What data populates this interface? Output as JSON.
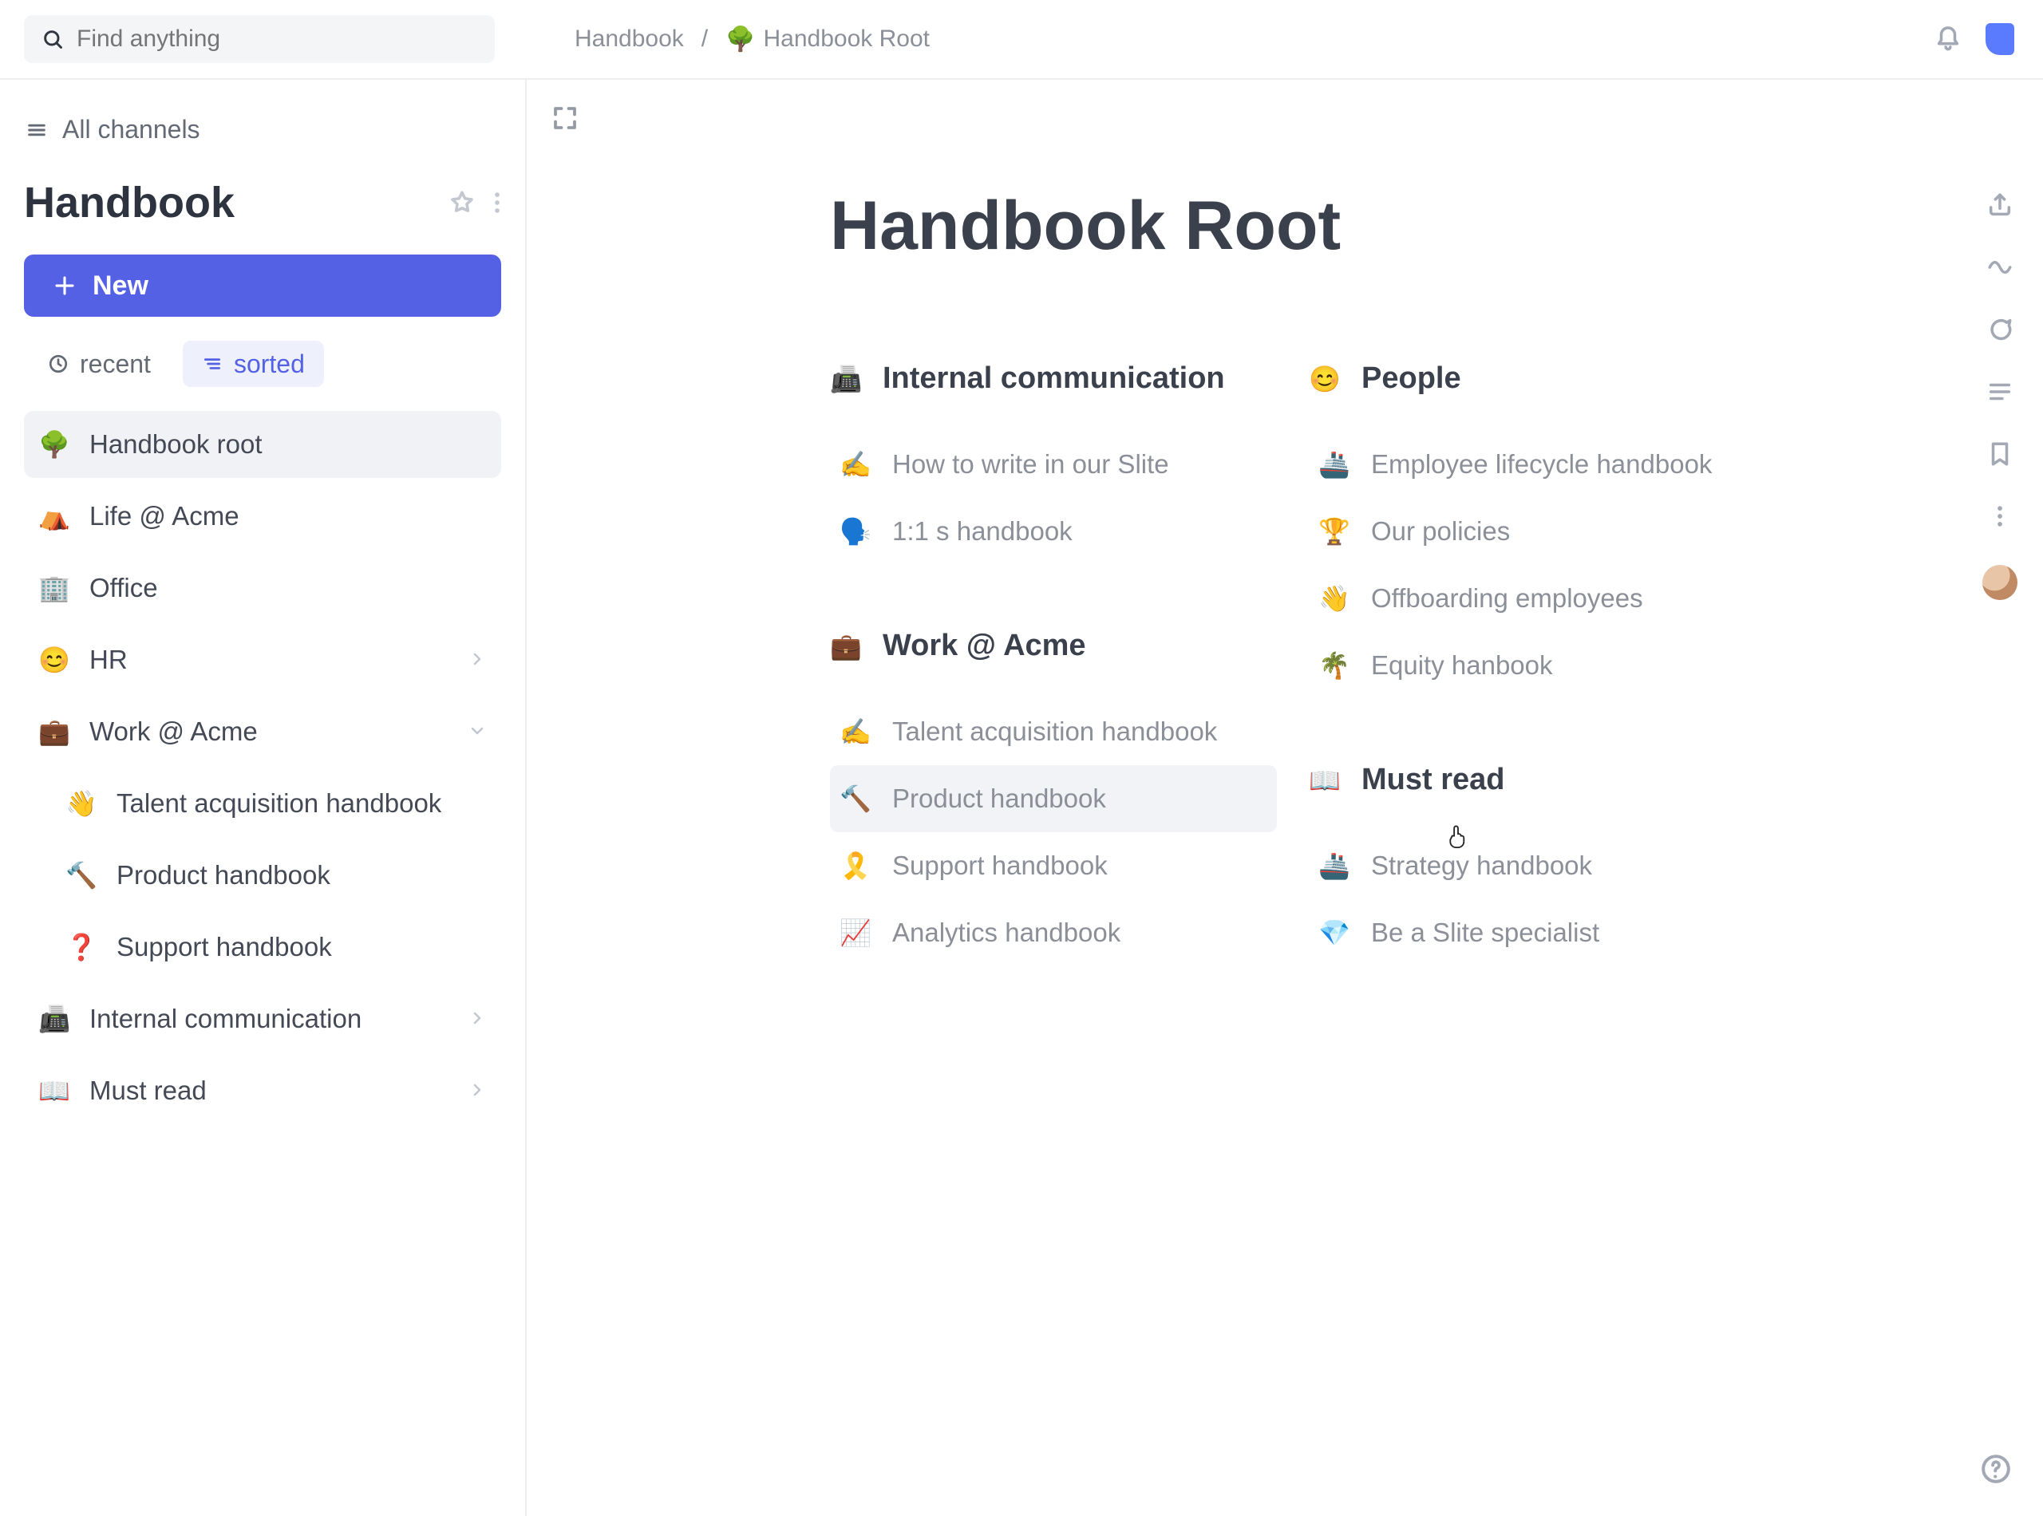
{
  "search": {
    "placeholder": "Find anything"
  },
  "breadcrumb": {
    "root": "Handbook",
    "separator": "/",
    "page_emoji": "🌳",
    "page": "Handbook Root"
  },
  "sidebar": {
    "all_channels": "All channels",
    "channel_title": "Handbook",
    "new_button": "New",
    "filters": {
      "recent": "recent",
      "sorted": "sorted"
    },
    "tree": [
      {
        "emoji": "🌳",
        "label": "Handbook root",
        "selected": true
      },
      {
        "emoji": "⛺",
        "label": "Life @ Acme"
      },
      {
        "emoji": "🏢",
        "label": "Office"
      },
      {
        "emoji": "😊",
        "label": "HR",
        "chevron": "right"
      },
      {
        "emoji": "💼",
        "label": "Work @ Acme",
        "chevron": "down"
      },
      {
        "emoji": "👋",
        "label": "Talent acquisition handbook",
        "child": true
      },
      {
        "emoji": "🔨",
        "label": "Product handbook",
        "child": true
      },
      {
        "emoji": "❓",
        "label": "Support handbook",
        "child": true
      },
      {
        "emoji": "📠",
        "label": "Internal communication",
        "chevron": "right"
      },
      {
        "emoji": "📖",
        "label": "Must read",
        "chevron": "right"
      }
    ]
  },
  "page": {
    "title": "Handbook Root"
  },
  "content": {
    "left": [
      {
        "head_emoji": "📠",
        "head": "Internal communication",
        "items": [
          {
            "emoji": "✍️",
            "label": "How to write in our Slite"
          },
          {
            "emoji": "🗣️",
            "label": "1:1 s handbook"
          }
        ]
      },
      {
        "head_emoji": "💼",
        "head": "Work @ Acme",
        "items": [
          {
            "emoji": "✍️",
            "label": "Talent acquisition handbook"
          },
          {
            "emoji": "🔨",
            "label": "Product handbook",
            "hover": true
          },
          {
            "emoji": "🎗️",
            "label": "Support handbook"
          },
          {
            "emoji": "📈",
            "label": "Analytics handbook"
          }
        ]
      }
    ],
    "right": [
      {
        "head_emoji": "😊",
        "head": "People",
        "items": [
          {
            "emoji": "🚢",
            "label": "Employee lifecycle handbook"
          },
          {
            "emoji": "🏆",
            "label": "Our policies"
          },
          {
            "emoji": "👋",
            "label": "Offboarding employees"
          },
          {
            "emoji": "🌴",
            "label": "Equity hanbook"
          }
        ]
      },
      {
        "head_emoji": "📖",
        "head": "Must read",
        "items": [
          {
            "emoji": "🚢",
            "label": "Strategy handbook"
          },
          {
            "emoji": "💎",
            "label": "Be a Slite specialist"
          }
        ]
      }
    ]
  }
}
